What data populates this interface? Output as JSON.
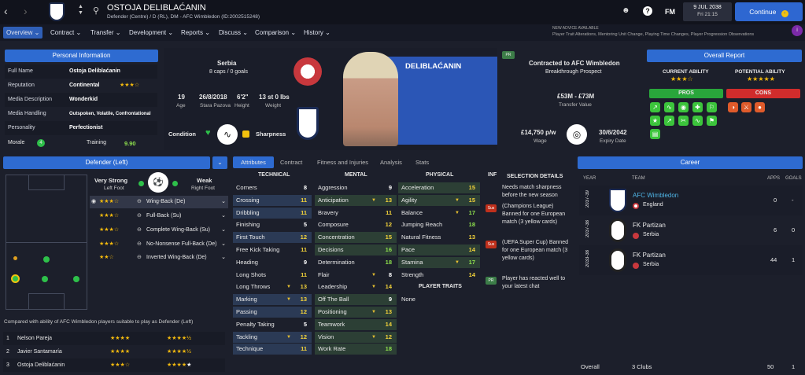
{
  "player": {
    "name": "OSTOJA DELIBLAĆANIN",
    "subtitle": "Defender (Centre) / D (RL), DM - AFC Wimbledon (ID:2002515248)",
    "short_name": "DELIBLAĆANIN"
  },
  "top": {
    "date": "9 JUL 2038",
    "time": "Fri 21:15",
    "continue": "Continue",
    "fm": "FM",
    "advice_title": "NEW ADVICE AVAILABLE",
    "advice_text": "Player Trait Alterations, Mentoring Unit Change, Playing Time Changes, Player Progression Observations"
  },
  "nav": [
    "Overview",
    "Contract",
    "Transfer",
    "Development",
    "Reports",
    "Discuss",
    "Comparison",
    "History"
  ],
  "personal": {
    "title": "Personal Information",
    "rows": [
      {
        "k": "Full Name",
        "v": "Ostoja Deliblaćanin"
      },
      {
        "k": "Reputation",
        "v": "Continental"
      },
      {
        "k": "Media Description",
        "v": "Wonderkid"
      },
      {
        "k": "Media Handling",
        "v": "Outspoken, Volatile, Confrontational"
      },
      {
        "k": "Personality",
        "v": "Perfectionist"
      }
    ],
    "morale": "Morale",
    "morale_val": "4",
    "training": "Training",
    "training_val": "9.90"
  },
  "bio": {
    "nation": "Serbia",
    "caps": "8 caps / 0 goals",
    "age": "19",
    "age_l": "Age",
    "dob": "26/8/2018",
    "place": "Stara Pazova",
    "height": "6'2\"",
    "height_l": "Height",
    "weight": "13 st 0 lbs",
    "weight_l": "Weight",
    "condition": "Condition",
    "sharpness": "Sharpness"
  },
  "contract": {
    "tag": "PR",
    "title": "Contracted to AFC Wimbledon",
    "sub": "Breakthrough Prospect",
    "value": "£53M - £73M",
    "value_l": "Transfer Value",
    "wage": "£14,750 p/w",
    "wage_l": "Wage",
    "expiry": "30/6/2042",
    "expiry_l": "Expiry Date"
  },
  "overall": {
    "title": "Overall Report",
    "ca": "CURRENT ABILITY",
    "pa": "POTENTIAL ABILITY",
    "pros": "PROS",
    "cons": "CONS"
  },
  "position": {
    "title": "Defender (Left)",
    "vs": "Very Strong",
    "lf": "Left Foot",
    "wk": "Weak",
    "rf": "Right Foot",
    "roles": [
      "Wing-Back (De)",
      "Full-Back (Su)",
      "Complete Wing-Back (Su)",
      "No-Nonsense Full-Back (De)",
      "Inverted Wing-Back (De)"
    ],
    "compare_text": "Compared with ability of AFC Wimbledon players suitable to play as Defender (Left)",
    "compare": [
      {
        "n": "1",
        "name": "Nelson Pareja"
      },
      {
        "n": "2",
        "name": "Javier Santamaría"
      },
      {
        "n": "3",
        "name": "Ostoja Deliblaćanin"
      }
    ]
  },
  "tabs": [
    "Attributes",
    "Contract",
    "Fitness and Injuries",
    "Analysis",
    "Stats"
  ],
  "attrs": {
    "tech_h": "TECHNICAL",
    "ment_h": "MENTAL",
    "phys_h": "PHYSICAL",
    "inf_h": "INF",
    "traits_h": "PLAYER TRAITS",
    "traits": "None",
    "tech": [
      [
        "Corners",
        "8"
      ],
      [
        "Crossing",
        "11"
      ],
      [
        "Dribbling",
        "11"
      ],
      [
        "Finishing",
        "5"
      ],
      [
        "First Touch",
        "12"
      ],
      [
        "Free Kick Taking",
        "11"
      ],
      [
        "Heading",
        "9"
      ],
      [
        "Long Shots",
        "11"
      ],
      [
        "Long Throws",
        "13"
      ],
      [
        "Marking",
        "13"
      ],
      [
        "Passing",
        "12"
      ],
      [
        "Penalty Taking",
        "5"
      ],
      [
        "Tackling",
        "12"
      ],
      [
        "Technique",
        "11"
      ]
    ],
    "ment": [
      [
        "Aggression",
        "9"
      ],
      [
        "Anticipation",
        "13"
      ],
      [
        "Bravery",
        "11"
      ],
      [
        "Composure",
        "12"
      ],
      [
        "Concentration",
        "15"
      ],
      [
        "Decisions",
        "16"
      ],
      [
        "Determination",
        "18"
      ],
      [
        "Flair",
        "8"
      ],
      [
        "Leadership",
        "14"
      ],
      [
        "Off The Ball",
        "9"
      ],
      [
        "Positioning",
        "13"
      ],
      [
        "Teamwork",
        "14"
      ],
      [
        "Vision",
        "12"
      ],
      [
        "Work Rate",
        "18"
      ]
    ],
    "phys": [
      [
        "Acceleration",
        "15"
      ],
      [
        "Agility",
        "15"
      ],
      [
        "Balance",
        "17"
      ],
      [
        "Jumping Reach",
        "18"
      ],
      [
        "Natural Fitness",
        "13"
      ],
      [
        "Pace",
        "14"
      ],
      [
        "Stamina",
        "17"
      ],
      [
        "Strength",
        "14"
      ]
    ]
  },
  "selection": {
    "title": "SELECTION DETAILS",
    "n1": "Needs match sharpness before the new season",
    "n2": "(Champions League) Banned for one European match (3 yellow cards)",
    "n3": "(UEFA Super Cup) Banned for one European match (3 yellow cards)",
    "n4": "Player has reacted well to your latest chat",
    "sus": "Sus",
    "pr": "PR"
  },
  "career": {
    "title": "Career",
    "year_h": "YEAR",
    "team_h": "TEAM",
    "apps_h": "APPS",
    "goals_h": "GOALS",
    "rows": [
      {
        "y": "2037-39",
        "team": "AFC Wimbledon",
        "nat": "England",
        "apps": "0",
        "goals": "-"
      },
      {
        "y": "2037-38",
        "team": "FK Partizan",
        "nat": "Serbia",
        "apps": "6",
        "goals": "0"
      },
      {
        "y": "2033-38",
        "team": "FK Partizan",
        "nat": "Serbia",
        "apps": "44",
        "goals": "1"
      }
    ],
    "overall": "Overall",
    "clubs": "3 Clubs",
    "tapps": "50",
    "tgoals": "1"
  }
}
